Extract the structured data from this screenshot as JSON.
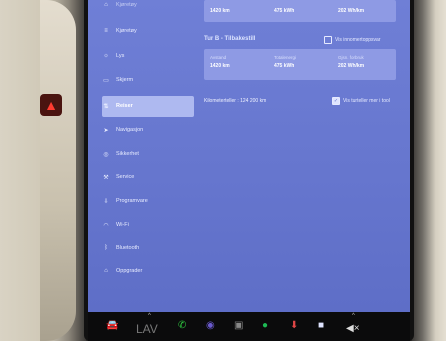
{
  "sidebar": {
    "items": [
      {
        "label": "Kjøretøy",
        "icon": "car-icon"
      },
      {
        "label": "Lys",
        "icon": "light-icon"
      },
      {
        "label": "Skjerm",
        "icon": "display-icon"
      },
      {
        "label": "Reiser",
        "icon": "trips-icon",
        "active": true
      },
      {
        "label": "Navigasjon",
        "icon": "navigation-icon"
      },
      {
        "label": "Sikkerhet",
        "icon": "lock-icon"
      },
      {
        "label": "Service",
        "icon": "wrench-icon"
      },
      {
        "label": "Programvare",
        "icon": "download-icon"
      },
      {
        "label": "Wi-Fi",
        "icon": "wifi-icon"
      },
      {
        "label": "Bluetooth",
        "icon": "bluetooth-icon"
      },
      {
        "label": "Oppgrader",
        "icon": "upgrade-icon"
      }
    ]
  },
  "trip_top": {
    "distance": "1420 km",
    "energy": "475 kWh",
    "avg": "202 Wh/km"
  },
  "trip_b": {
    "title": "Tur B - Tilbakestill",
    "reset_checkbox_label": "Vis innomertoppsvar",
    "labels": {
      "distance": "Avstand",
      "energy": "Totalenergi",
      "avg": "Gjsn. forbruk"
    },
    "values": {
      "distance": "1420 km",
      "energy": "475 kWh",
      "avg": "202 Wh/km"
    }
  },
  "odometer": {
    "label": "Kilometerteller : 124 200 km",
    "checkbox_label": "Vis turteller mer i tool"
  },
  "taskbar": {
    "temp_label": "LAV"
  },
  "colors": {
    "screen_bg": "#6777cf",
    "panel_bg": "#8e9ae4",
    "active_nav": "#aeb9f0"
  }
}
